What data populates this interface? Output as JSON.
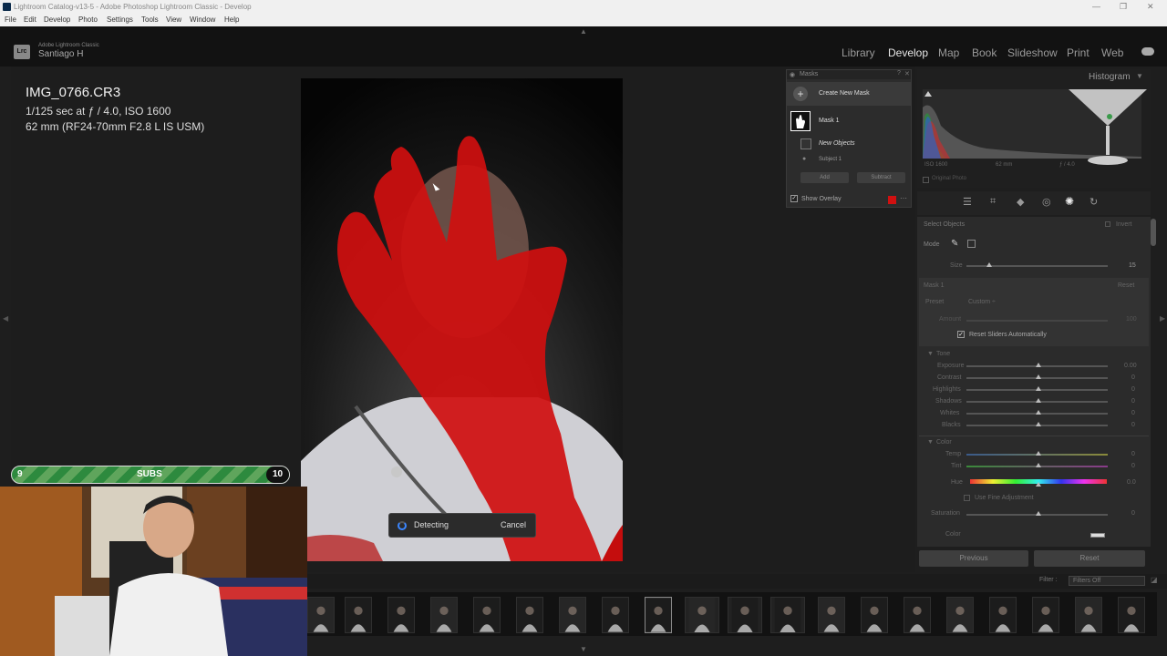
{
  "window": {
    "title": "Lightroom Catalog-v13-5 - Adobe Photoshop Lightroom Classic - Develop",
    "controls": [
      "—",
      "❐",
      "✕"
    ]
  },
  "menu": [
    "File",
    "Edit",
    "Develop",
    "Photo",
    "Settings",
    "Tools",
    "View",
    "Window",
    "Help"
  ],
  "identity": {
    "logo": "Lrc",
    "catalog": "Adobe Lightroom Classic",
    "user": "Santiago H"
  },
  "modules": [
    "Library",
    "Develop",
    "Map",
    "Book",
    "Slideshow",
    "Print",
    "Web"
  ],
  "active_module": "Develop",
  "photo_info": {
    "filename": "IMG_0766.CR3",
    "exposure": "1/125 sec at ƒ / 4.0, ISO 1600",
    "lens": "62 mm (RF24-70mm F2.8 L IS USM)"
  },
  "detect_dialog": {
    "status": "Detecting",
    "cancel": "Cancel"
  },
  "subs_bar": {
    "start": "9",
    "label": "SUBS",
    "end": "10"
  },
  "masks": {
    "header": "Masks",
    "create_new": "Create New Mask",
    "mask_name": "Mask 1",
    "components": [
      "New Objects",
      "Subject 1"
    ],
    "add": "Add",
    "subtract": "Subtract",
    "show_overlay": "Show Overlay",
    "overlay_color": "#d01010"
  },
  "histogram": {
    "title": "Histogram",
    "iso": "ISO 1600",
    "focal": "62 mm",
    "aperture": "ƒ / 4.0",
    "original_photo": "Original Photo"
  },
  "select_objects": {
    "title": "Select Objects",
    "invert": "Invert",
    "mode_label": "Mode",
    "size_label": "Size",
    "size_value": "15"
  },
  "mask_settings": {
    "title": "Mask 1",
    "reset": "Reset",
    "preset_label": "Preset",
    "preset_value": "Custom ÷",
    "amount_label": "Amount",
    "amount_value": "100",
    "reset_sliders": "Reset Sliders Automatically"
  },
  "tone": {
    "title": "Tone",
    "rows": [
      {
        "label": "Exposure",
        "value": "0.00"
      },
      {
        "label": "Contrast",
        "value": "0"
      },
      {
        "label": "Highlights",
        "value": "0"
      },
      {
        "label": "Shadows",
        "value": "0"
      },
      {
        "label": "Whites",
        "value": "0"
      },
      {
        "label": "Blacks",
        "value": "0"
      }
    ]
  },
  "color": {
    "title": "Color",
    "rows": [
      {
        "label": "Temp",
        "value": "0"
      },
      {
        "label": "Tint",
        "value": "0"
      },
      {
        "label": "Hue",
        "value": "0.0"
      }
    ],
    "fine_adjust": "Use Fine Adjustment",
    "saturation_label": "Saturation",
    "saturation_value": "0",
    "color_label": "Color"
  },
  "footer": {
    "previous": "Previous",
    "reset": "Reset"
  },
  "filmstrip": {
    "filter_label": "Filter :",
    "filter_value": "Filters Off"
  }
}
